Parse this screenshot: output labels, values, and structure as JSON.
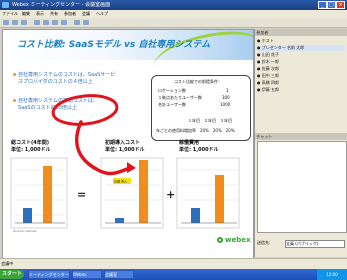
{
  "window": {
    "title": "Webex ミーティングセンター - 会議室画面"
  },
  "menu": [
    "ファイル",
    "編集",
    "表示",
    "共有",
    "参加者",
    "会議",
    "ヘルプ"
  ],
  "slide": {
    "title": "コスト比較: SaaSモデル vs 自社専用システム",
    "bullets": [
      [
        "自社専用システムのコストは、SaaSサービ",
        "スプロバイダのコストの４倍以上"
      ],
      [
        "自社専用システムの初期コストは、",
        "SaaSのコストの10倍以上"
      ]
    ],
    "infobox": {
      "heading": "コスト比較での前提条件：",
      "rows": [
        {
          "label": "ロケーション数",
          "value": "3"
        },
        {
          "label": "１拠点あたりユーザー数",
          "value": "300"
        },
        {
          "label": "合計ユーザー数",
          "value": "1000"
        }
      ],
      "years": "１年目　２年目　３年目",
      "footer": "年ごとの使用料増加率　20%　20%　20%"
    },
    "charts": [
      {
        "title": "総コスト(4年間)",
        "unit": "単位: 1,000ドル",
        "color": "#f28c1a"
      },
      {
        "title": "初期導入コスト",
        "unit": "単位: 1,000ドル",
        "color": "#f28c1a"
      },
      {
        "title": "稼働費用",
        "unit": "単位: 1,000ドル",
        "color": "#f28c1a"
      }
    ],
    "operators": [
      "=",
      "+"
    ],
    "mid_legend": "高額 導入",
    "source": "Source: Gartner",
    "brand": "webex"
  },
  "side": {
    "participants_header": "参加者",
    "participants": [
      {
        "name": "ホスト"
      },
      {
        "name": "プレゼンター 名前 太郎"
      },
      {
        "name": "山田 花子"
      },
      {
        "name": "鈴木 一郎"
      },
      {
        "name": "佐藤 次郎"
      },
      {
        "name": "田中 三郎"
      },
      {
        "name": "高橋 四郎"
      },
      {
        "name": "伊藤 五郎"
      }
    ],
    "chat_header": "チャット",
    "send_label": "送信先:",
    "send_value": "全員 (パブリック)"
  },
  "status": {
    "text": "会議中"
  },
  "taskbar": {
    "start": "スタート",
    "items": [
      "ミーティングセンター",
      "Webex",
      "会議室"
    ],
    "clock": "12:00"
  }
}
